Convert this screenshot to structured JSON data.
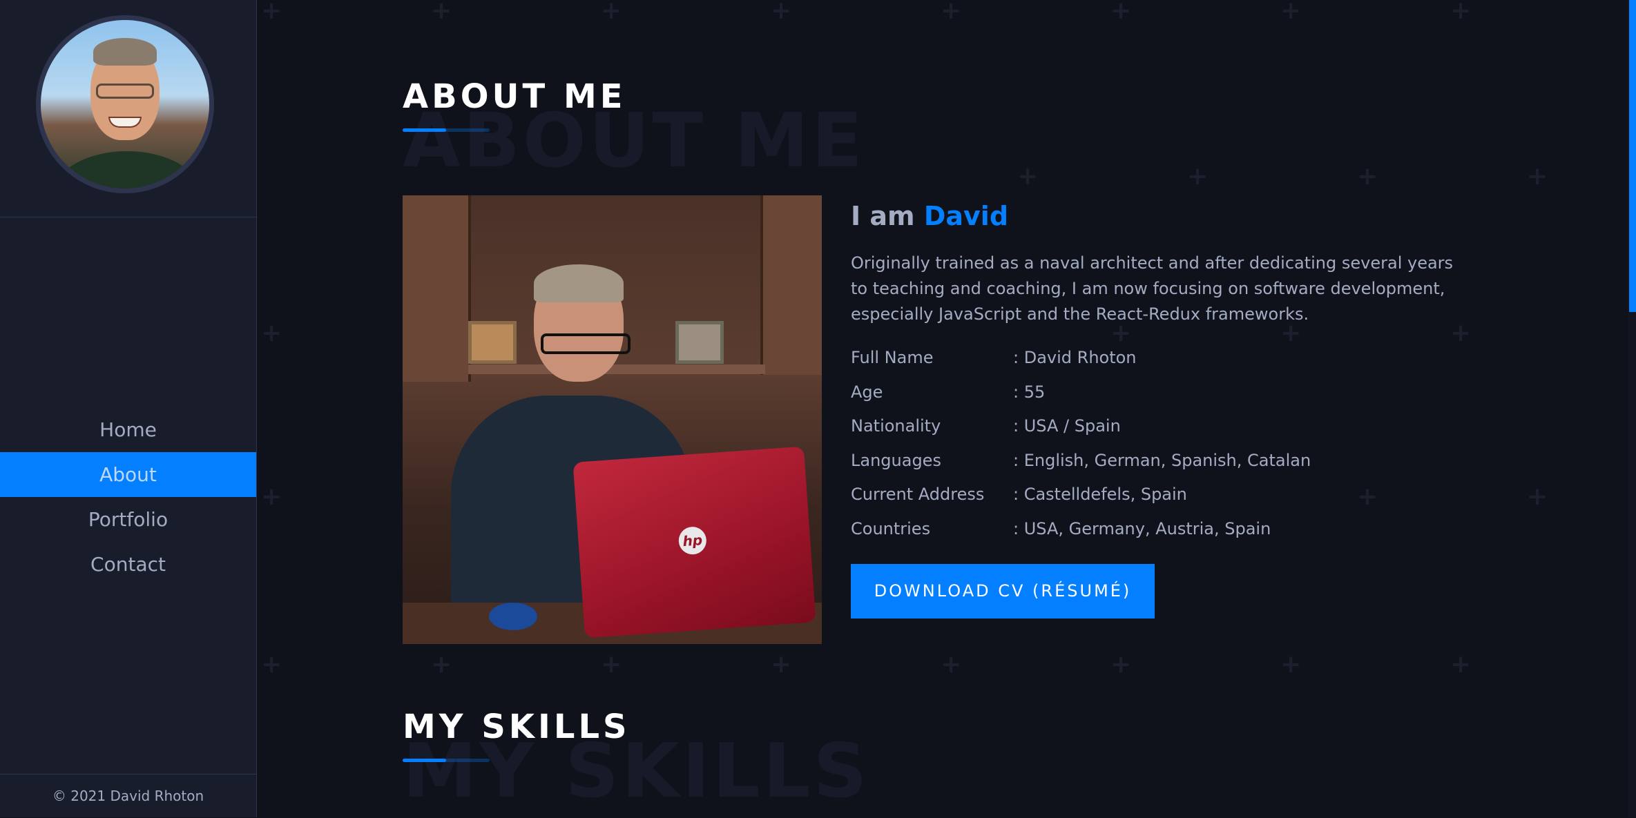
{
  "sidebar": {
    "nav": [
      {
        "label": "Home",
        "active": false
      },
      {
        "label": "About",
        "active": true
      },
      {
        "label": "Portfolio",
        "active": false
      },
      {
        "label": "Contact",
        "active": false
      }
    ],
    "footer": "© 2021 David Rhoton"
  },
  "about": {
    "title": "ABOUT ME",
    "bg_title": "ABOUT ME",
    "greeting_prefix": "I am",
    "greeting_name": "David",
    "bio": "Originally trained as a naval architect and after dedicating several years to teaching and coaching, I am now focusing on software development, especially JavaScript and the React-Redux frameworks.",
    "facts": [
      {
        "label": "Full Name",
        "value": ": David Rhoton"
      },
      {
        "label": "Age",
        "value": ": 55"
      },
      {
        "label": "Nationality",
        "value": ": USA / Spain"
      },
      {
        "label": "Languages",
        "value": ": English, German, Spanish, Catalan"
      },
      {
        "label": "Current Address",
        "value": ": Castelldefels, Spain"
      },
      {
        "label": "Countries",
        "value": ": USA, Germany, Austria, Spain"
      }
    ],
    "cv_button": "DOWNLOAD CV (RÉSUMÉ)",
    "laptop_logo": "hp"
  },
  "skills": {
    "title": "MY SKILLS",
    "bg_title": "MY SKILLS"
  },
  "colors": {
    "accent": "#037fff",
    "sidebar_bg": "#191d2b",
    "page_bg": "#10121b",
    "text": "#a4acc4"
  }
}
